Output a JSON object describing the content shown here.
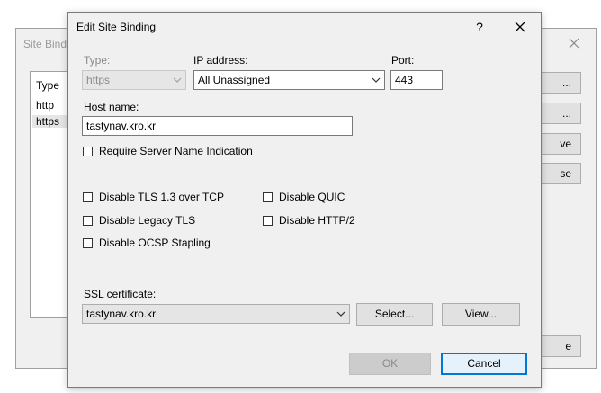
{
  "background_dialog": {
    "title": "Site Bindi",
    "list_header": "Type",
    "list_items": [
      "http",
      "https"
    ],
    "buttons": [
      "...",
      "...",
      "ve",
      "se",
      "e"
    ]
  },
  "dialog": {
    "title": "Edit Site Binding",
    "help_glyph": "?",
    "type_label": "Type:",
    "type_value": "https",
    "ip_label": "IP address:",
    "ip_value": "All Unassigned",
    "port_label": "Port:",
    "port_value": "443",
    "host_label": "Host name:",
    "host_value": "tastynav.kro.kr",
    "sni_label": "Require Server Name Indication",
    "options": {
      "tls13": "Disable TLS 1.3 over TCP",
      "quic": "Disable QUIC",
      "legacy_tls": "Disable Legacy TLS",
      "http2": "Disable HTTP/2",
      "ocsp": "Disable OCSP Stapling"
    },
    "ssl_label": "SSL certificate:",
    "ssl_value": "tastynav.kro.kr",
    "select_label": "Select...",
    "view_label": "View...",
    "ok_label": "OK",
    "cancel_label": "Cancel"
  },
  "colors": {
    "accent": "#0078d7",
    "dialog_bg": "#f0f0f0",
    "disabled_text": "#8a8a8a"
  }
}
